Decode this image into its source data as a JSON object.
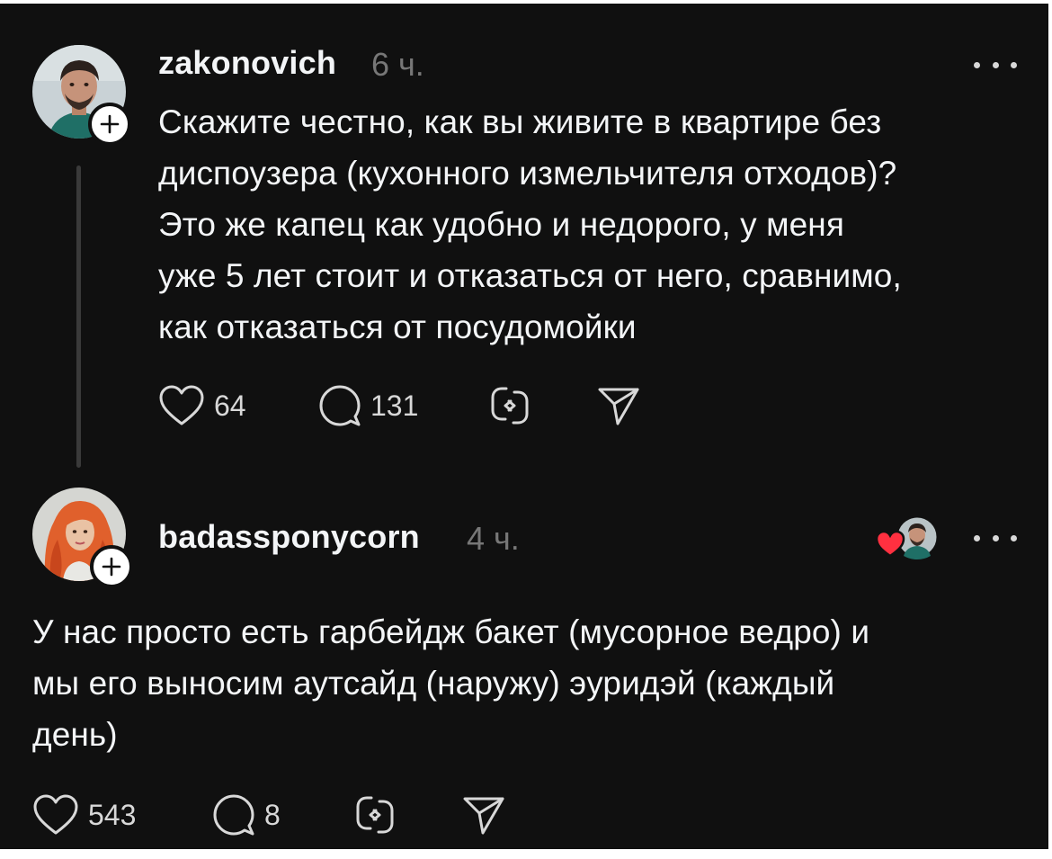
{
  "thread": {
    "posts": [
      {
        "username": "zakonovich",
        "time": "6 ч.",
        "text": "Скажите честно, как вы живите в квартире без\nдиспоузера (кухонного измельчителя отходов)?\nЭто же капец как удобно и недорого, у меня\nуже 5 лет стоит и отказаться от него, сравнимо,\nкак отказаться от посудомойки",
        "likes": "64",
        "replies": "131"
      },
      {
        "username": "badassponycorn",
        "time": "4 ч.",
        "text": "У нас просто есть гарбейдж бакет (мусорное ведро) и\nмы его выносим аутсайд (наружу) эуридэй (каждый\nдень)",
        "likes": "543",
        "replies": "8"
      }
    ]
  },
  "icons": {
    "like": "heart-icon",
    "reply": "comment-icon",
    "repost": "repost-icon",
    "share": "send-icon",
    "more": "more-icon",
    "follow": "plus-icon",
    "liked_by_author": "red-heart-icon"
  },
  "colors": {
    "background": "#101010",
    "text": "#f3f5f7",
    "muted": "#777777",
    "like_red": "#ff3040"
  }
}
